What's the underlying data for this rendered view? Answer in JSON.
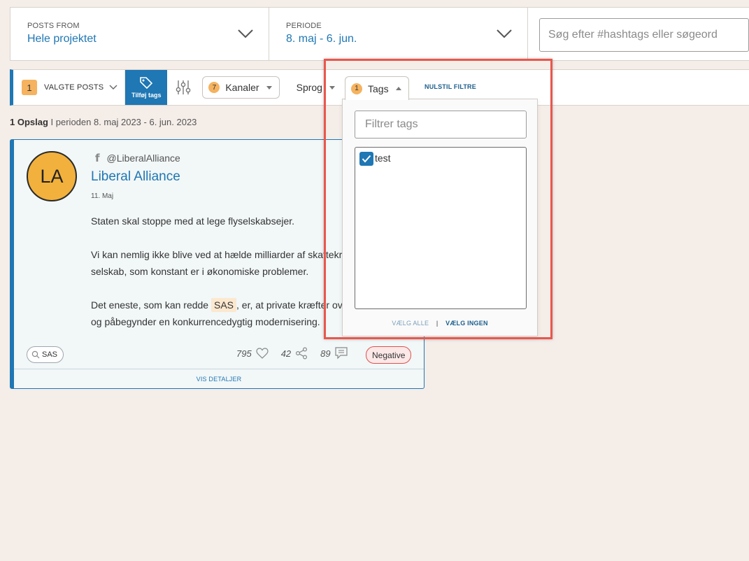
{
  "topbar": {
    "posts_from_label": "POSTS FROM",
    "posts_from_value": "Hele projektet",
    "period_label": "PERIODE",
    "period_value": "8. maj - 6. jun.",
    "search_placeholder": "Søg efter #hashtags eller søgeord"
  },
  "toolbar": {
    "selected_count": "1",
    "selected_label": "VALGTE POSTS",
    "add_tags_label": "Tilføj tags",
    "channels_count": "7",
    "channels_label": "Kanaler",
    "language_label": "Sprog",
    "tags_count": "1",
    "tags_label": "Tags",
    "reset_label": "NULSTIL FILTRE"
  },
  "results": {
    "count": "1 Opslag",
    "period_text": "I perioden 8. maj 2023 - 6. jun. 2023"
  },
  "post": {
    "avatar_initials": "LA",
    "handle": "@LiberalAlliance",
    "author": "Liberal Alliance",
    "date": "11. Maj",
    "para1": "Staten skal stoppe med at lege flyselskabsejer.",
    "para2_line1": "Vi kan nemlig ikke blive ved at hælde milliarder af skattekr",
    "para2_line2": "selskab, som konstant er i økonomiske problemer.",
    "para3_before": "Det eneste, som kan redde ",
    "para3_keyword": "SAS",
    "para3_after": ", er, at private kræfter ove",
    "para3_line2": "og påbegynder en konkurrencedygtig modernisering.",
    "keyword_chip": "SAS",
    "likes": "795",
    "shares": "42",
    "comments": "89",
    "sentiment": "Negative",
    "details_label": "VIS DETALJER"
  },
  "tags_dropdown": {
    "filter_placeholder": "Filtrer tags",
    "items": [
      {
        "label": "test",
        "checked": true
      }
    ],
    "select_all": "VÆLG ALLE",
    "separator": "|",
    "select_none": "VÆLG INGEN"
  },
  "colors": {
    "accent": "#1f77b4",
    "badge": "#f5b25f",
    "highlight": "#e8574d",
    "background": "#f5ede8"
  }
}
